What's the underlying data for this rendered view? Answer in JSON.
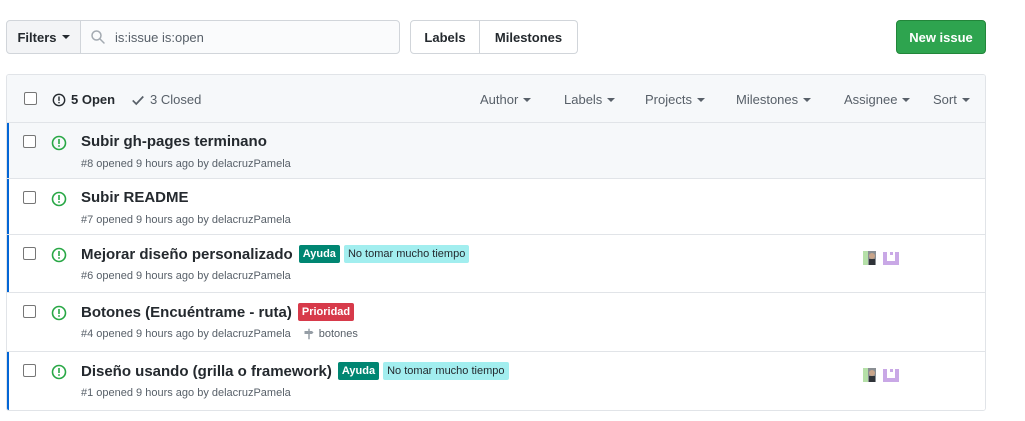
{
  "toolbar": {
    "filters_label": "Filters",
    "search_value": "is:issue is:open",
    "labels_label": "Labels",
    "milestones_label": "Milestones",
    "new_issue_label": "New issue"
  },
  "header": {
    "open_label": "5 Open",
    "closed_label": "3 Closed",
    "filters": {
      "author": "Author",
      "labels": "Labels",
      "projects": "Projects",
      "milestones": "Milestones",
      "assignee": "Assignee",
      "sort": "Sort"
    }
  },
  "colors": {
    "accent_green": "#2ea44f",
    "open_icon": "#28a745",
    "unread_bar": "#0366d6",
    "label_ayuda": "#008672",
    "label_tiempo": "#a2eeef",
    "label_prioridad": "#d73a4a"
  },
  "issues": [
    {
      "title": "Subir gh-pages terminano",
      "meta": "#8 opened 9 hours ago by delacruzPamela",
      "labels": [],
      "milestone": ""
    },
    {
      "title": "Subir README",
      "meta": "#7 opened 9 hours ago by delacruzPamela",
      "labels": [],
      "milestone": ""
    },
    {
      "title": "Mejorar diseño personalizado",
      "meta": "#6 opened 9 hours ago by delacruzPamela",
      "labels": [
        "Ayuda",
        "No tomar mucho tiempo"
      ],
      "milestone": ""
    },
    {
      "title": "Botones (Encuéntrame - ruta)",
      "meta": "#4 opened 9 hours ago by delacruzPamela",
      "labels": [
        "Prioridad"
      ],
      "milestone": "botones"
    },
    {
      "title": "Diseño usando (grilla o framework)",
      "meta": "#1 opened 9 hours ago by delacruzPamela",
      "labels": [
        "Ayuda",
        "No tomar mucho tiempo"
      ],
      "milestone": ""
    }
  ]
}
